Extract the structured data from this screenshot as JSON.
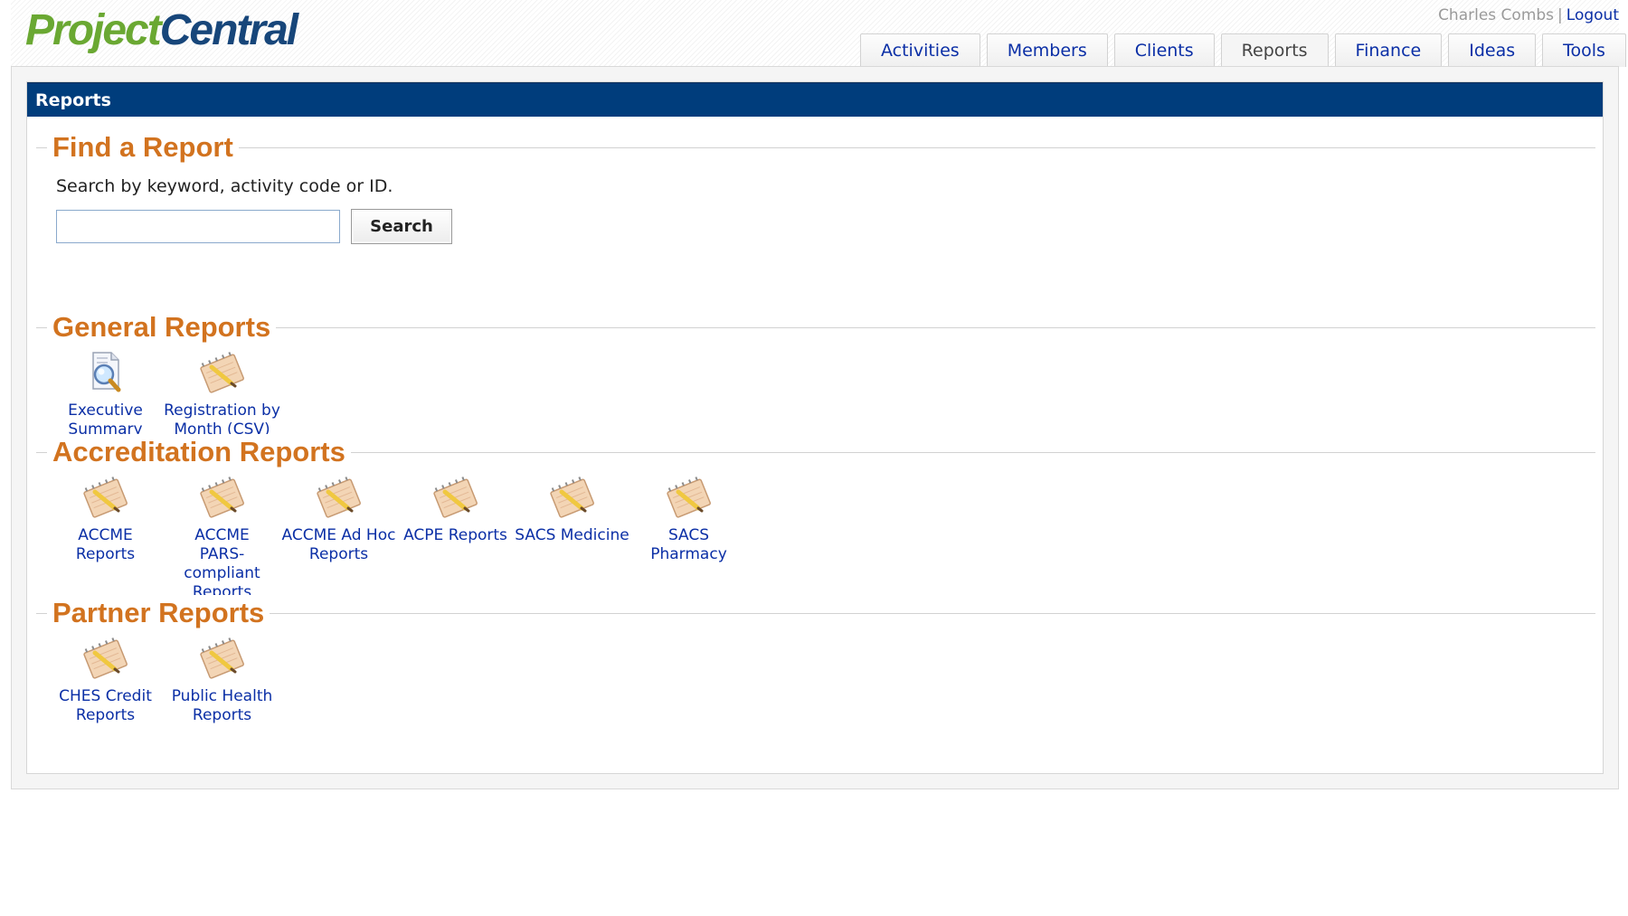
{
  "app": {
    "logo": {
      "part1": "Project",
      "part2": "Central"
    },
    "user": {
      "name": "Charles Combs",
      "separator": "|",
      "logout": "Logout"
    },
    "tabs": [
      {
        "label": "Activities",
        "active": false
      },
      {
        "label": "Members",
        "active": false
      },
      {
        "label": "Clients",
        "active": false
      },
      {
        "label": "Reports",
        "active": true
      },
      {
        "label": "Finance",
        "active": false
      },
      {
        "label": "Ideas",
        "active": false
      },
      {
        "label": "Tools",
        "active": false
      }
    ]
  },
  "panel": {
    "title": "Reports",
    "find": {
      "heading": "Find a Report",
      "hint": "Search by keyword, activity code or ID.",
      "input_value": "",
      "button": "Search"
    },
    "general": {
      "heading": "General Reports",
      "items": [
        {
          "icon": "magnifier-document-icon",
          "label_lines": [
            "Executive",
            "Summary"
          ]
        },
        {
          "icon": "notebook-pencil-icon",
          "label_lines": [
            "Registration by",
            "Month (CSV)"
          ]
        }
      ]
    },
    "accreditation": {
      "heading": "Accreditation Reports",
      "items": [
        {
          "icon": "notebook-pencil-icon",
          "label_lines": [
            "ACCME Reports"
          ]
        },
        {
          "icon": "notebook-pencil-icon",
          "label_lines": [
            "ACCME",
            "PARS-compliant",
            "Reports"
          ]
        },
        {
          "icon": "notebook-pencil-icon",
          "label_lines": [
            "ACCME Ad Hoc",
            "Reports"
          ]
        },
        {
          "icon": "notebook-pencil-icon",
          "label_lines": [
            "ACPE Reports"
          ]
        },
        {
          "icon": "notebook-pencil-icon",
          "label_lines": [
            "SACS Medicine"
          ]
        },
        {
          "icon": "notebook-pencil-icon",
          "label_lines": [
            "SACS",
            "Pharmacy"
          ]
        }
      ]
    },
    "partner": {
      "heading": "Partner Reports",
      "items": [
        {
          "icon": "notebook-pencil-icon",
          "label_lines": [
            "CHES Credit",
            "Reports"
          ]
        },
        {
          "icon": "notebook-pencil-icon",
          "label_lines": [
            "Public Health",
            "Reports"
          ]
        }
      ]
    }
  },
  "colors": {
    "brand_green": "#6aa832",
    "brand_blue": "#17467a",
    "panel_header": "#003d7c",
    "section_heading": "#d2731f",
    "link": "#0b2fa6"
  }
}
